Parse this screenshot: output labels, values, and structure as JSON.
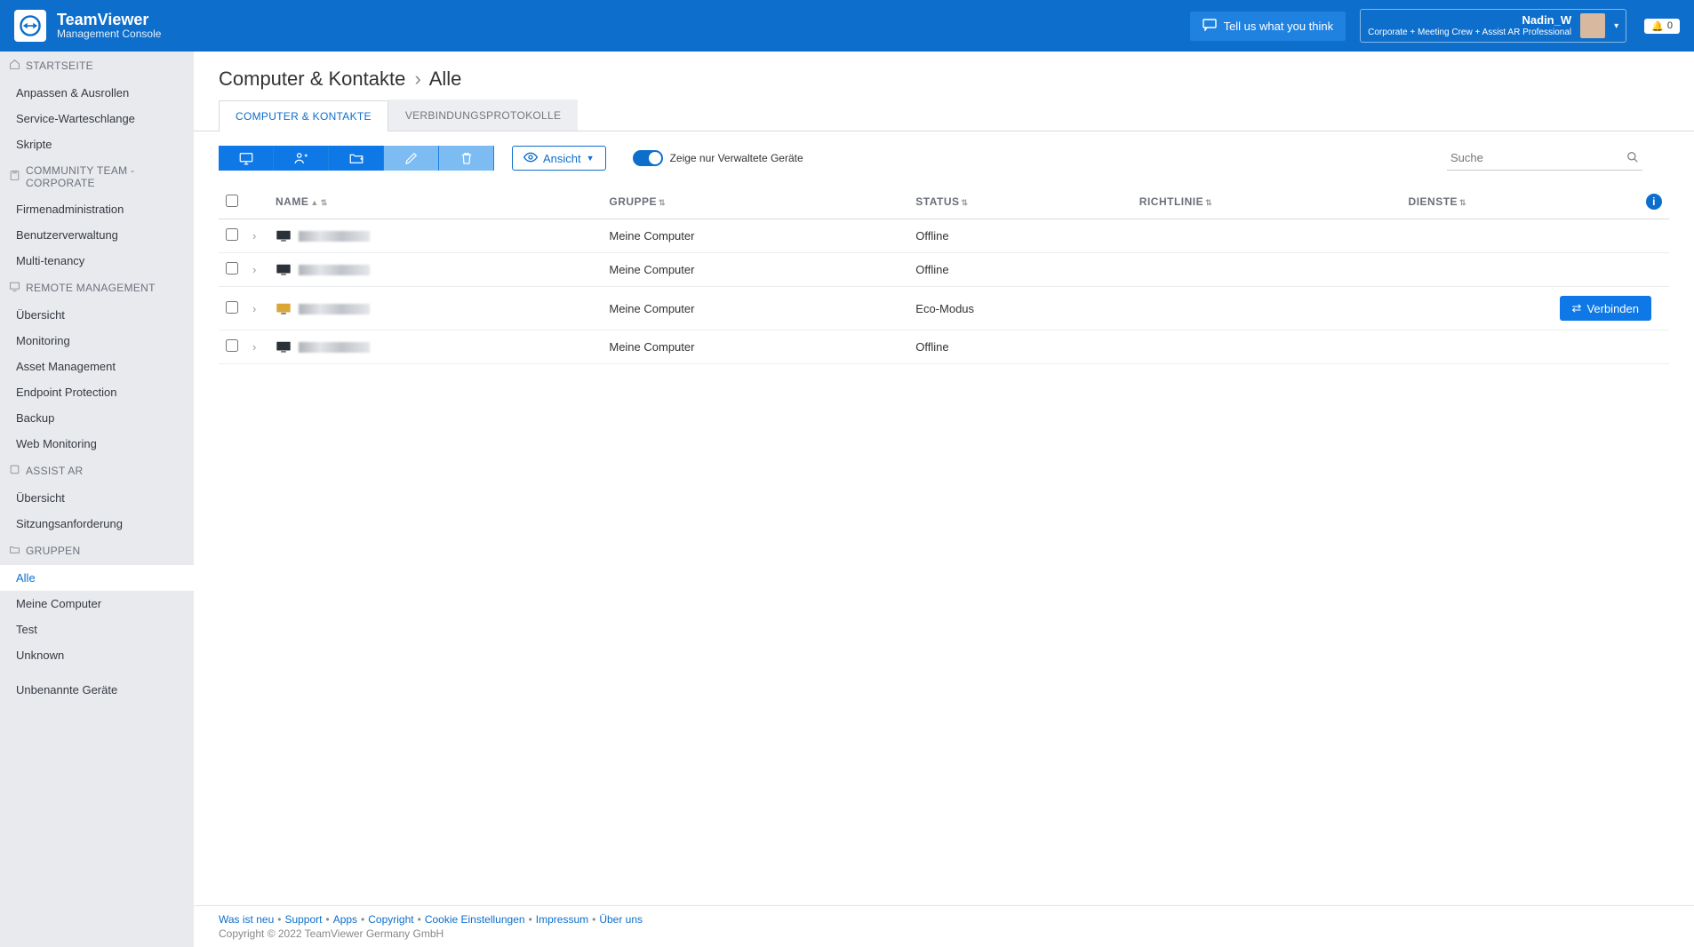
{
  "brand": {
    "title": "TeamViewer",
    "subtitle": "Management Console"
  },
  "header": {
    "feedback": "Tell us what you think",
    "user_name": "Nadin_W",
    "user_plan": "Corporate + Meeting Crew + Assist AR Professional",
    "notif_count": "0"
  },
  "sidebar": {
    "sections": [
      {
        "title": "STARTSEITE",
        "items": [
          "Anpassen & Ausrollen",
          "Service-Warteschlange",
          "Skripte"
        ]
      },
      {
        "title": "COMMUNITY TEAM - CORPORATE",
        "items": [
          "Firmenadministration",
          "Benutzerverwaltung",
          "Multi-tenancy"
        ]
      },
      {
        "title": "REMOTE MANAGEMENT",
        "items": [
          "Übersicht",
          "Monitoring",
          "Asset Management",
          "Endpoint Protection",
          "Backup",
          "Web Monitoring"
        ]
      },
      {
        "title": "ASSIST AR",
        "items": [
          "Übersicht",
          "Sitzungsanforderung"
        ]
      },
      {
        "title": "GRUPPEN",
        "items": [
          "Alle",
          "Meine Computer",
          "Test",
          "Unknown",
          "",
          "Unbenannte Geräte"
        ],
        "active": 0
      }
    ]
  },
  "page": {
    "crumb1": "Computer & Kontakte",
    "crumb2": "Alle",
    "tabs": [
      "COMPUTER & KONTAKTE",
      "VERBINDUNGSPROTOKOLLE"
    ],
    "active_tab": 0
  },
  "toolbar": {
    "view_label": "Ansicht",
    "toggle_label": "Zeige nur Verwaltete Geräte",
    "search_placeholder": "Suche"
  },
  "table": {
    "cols": [
      "NAME",
      "GRUPPE",
      "STATUS",
      "RICHTLINIE",
      "DIENSTE"
    ],
    "rows": [
      {
        "group": "Meine Computer",
        "status": "Offline",
        "icon": "dark",
        "connect": false
      },
      {
        "group": "Meine Computer",
        "status": "Offline",
        "icon": "dark",
        "connect": false
      },
      {
        "group": "Meine Computer",
        "status": "Eco-Modus",
        "icon": "gold",
        "connect": true
      },
      {
        "group": "Meine Computer",
        "status": "Offline",
        "icon": "dark",
        "connect": false
      }
    ],
    "connect_label": "Verbinden"
  },
  "footer": {
    "links": [
      "Was ist neu",
      "Support",
      "Apps",
      "Copyright",
      "Cookie Einstellungen",
      "Impressum",
      "Über uns"
    ],
    "copyright": "Copyright © 2022 TeamViewer Germany GmbH"
  }
}
